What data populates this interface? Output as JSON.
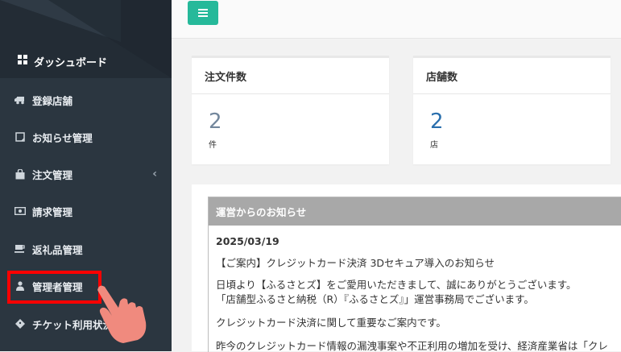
{
  "sidebar": {
    "dashboard": "ダッシュボード",
    "items": [
      {
        "label": "登録店舗",
        "icon": "truck-icon"
      },
      {
        "label": "お知らせ管理",
        "icon": "note-icon"
      },
      {
        "label": "注文管理",
        "icon": "shopping-bag-icon",
        "chevron": "‹"
      },
      {
        "label": "請求管理",
        "icon": "money-icon"
      },
      {
        "label": "返礼品管理",
        "icon": "coffee-icon"
      },
      {
        "label": "管理者管理",
        "icon": "user-icon"
      },
      {
        "label": "チケット利用状況",
        "icon": "ticket-icon"
      }
    ]
  },
  "cards": [
    {
      "title": "注文件数",
      "value": "2",
      "unit": "件"
    },
    {
      "title": "店舗数",
      "value": "2",
      "unit": "店"
    }
  ],
  "notice": {
    "header": "運営からのお知らせ",
    "date": "2025/03/19",
    "title": "【ご案内】クレジットカード決済 3Dセキュア導入のお知らせ",
    "line1": "日頃より【ふるさとズ】をご愛用いただきまして、誠にありがとうございます。",
    "line2": "「店舗型ふるさと納税（R）『ふるさとズ』」運営事務局でございます。",
    "line3": "クレジットカード決済に関して重要なご案内です。",
    "line4": "昨今のクレジットカード情報の漏洩事案や不正利用の増加を受け、経済産業省は「クレ"
  },
  "colors": {
    "sidebar_bg": "#2b3640",
    "menu_button": "#26b99a",
    "highlight": "#ff0000",
    "pointer_hand": "#f08a7e"
  }
}
